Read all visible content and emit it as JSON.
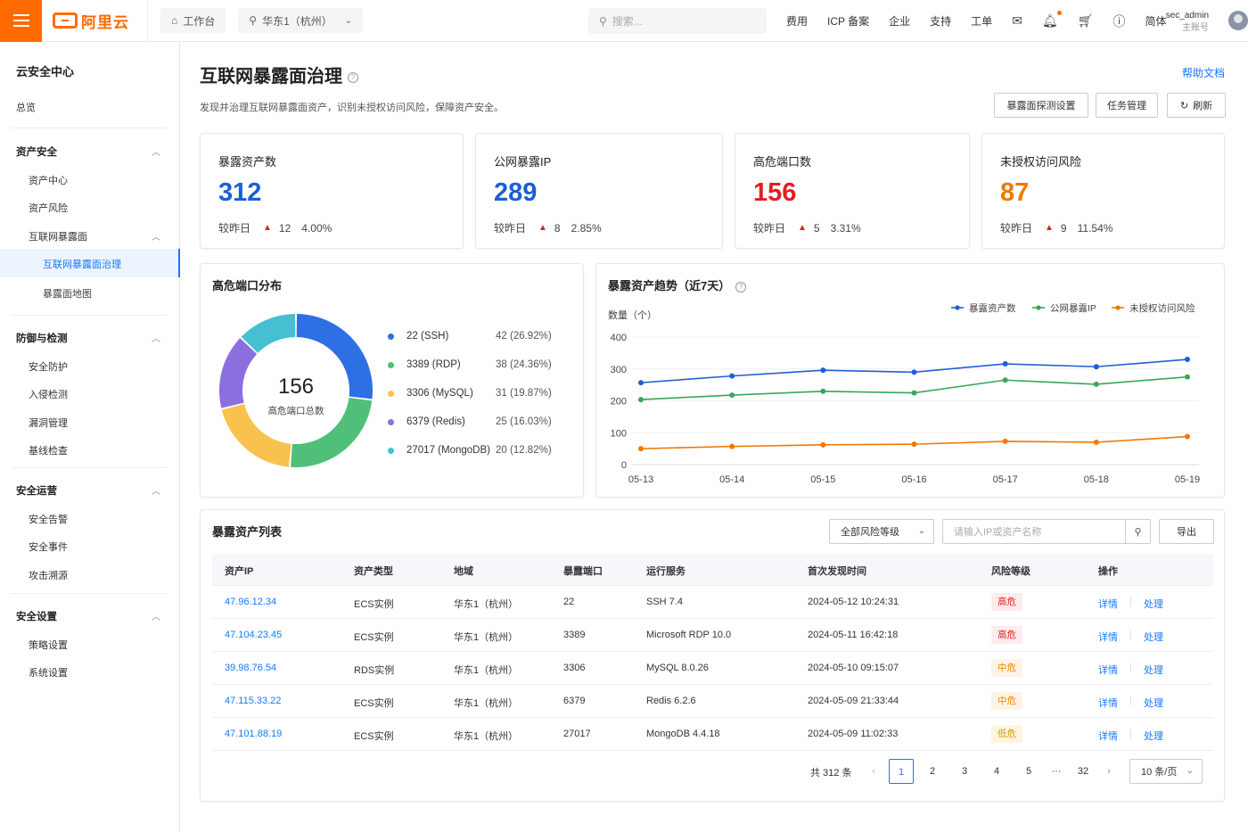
{
  "topbar": {
    "brand": "阿里云",
    "workbench": "工作台",
    "region": "华东1（杭州）",
    "search_placeholder": "搜索...",
    "nav": [
      "费用",
      "ICP 备案",
      "企业",
      "支持",
      "工单"
    ],
    "lang": "简体",
    "user_name": "sec_admin",
    "user_role": "主账号"
  },
  "sidebar": {
    "title": "云安全中心",
    "overview": "总览",
    "groups": [
      {
        "label": "资产安全",
        "items": [
          "资产中心",
          "资产风险"
        ]
      },
      {
        "label": "防御与检测",
        "items": [
          "安全防护",
          "入侵检测",
          "漏洞管理",
          "基线检查"
        ]
      },
      {
        "label": "安全运营",
        "items": [
          "安全告警",
          "安全事件",
          "攻击溯源"
        ]
      },
      {
        "label": "安全设置",
        "items": [
          "策略设置",
          "系统设置"
        ]
      }
    ],
    "sub_group": "互联网暴露面",
    "sub_items": [
      "互联网暴露面治理",
      "暴露面地图"
    ]
  },
  "page": {
    "title": "互联网暴露面治理",
    "help": "帮助文档",
    "desc": "发现并治理互联网暴露面资产，识别未授权访问风险，保障资产安全。",
    "buttons": {
      "probe": "暴露面探测设置",
      "task": "任务管理",
      "refresh": "刷新"
    }
  },
  "stats": [
    {
      "label": "暴露资产数",
      "value": "312",
      "cmp": "较昨日",
      "delta": "12",
      "pct": "4.00%",
      "color": "#1a5fd6"
    },
    {
      "label": "公网暴露IP",
      "value": "289",
      "cmp": "较昨日",
      "delta": "8",
      "pct": "2.85%",
      "color": "#1a5fd6"
    },
    {
      "label": "高危端口数",
      "value": "156",
      "cmp": "较昨日",
      "delta": "5",
      "pct": "3.31%",
      "color": "#e02020"
    },
    {
      "label": "未授权访问风险",
      "value": "87",
      "cmp": "较昨日",
      "delta": "9",
      "pct": "11.54%",
      "color": "#f07800"
    }
  ],
  "donut": {
    "title": "高危端口分布",
    "center_value": "156",
    "center_label": "高危端口总数",
    "legend": [
      {
        "name": "22 (SSH)",
        "pct": "42 (26.92%)"
      },
      {
        "name": "3389 (RDP)",
        "pct": "38 (24.36%)"
      },
      {
        "name": "3306 (MySQL)",
        "pct": "31 (19.87%)"
      },
      {
        "name": "6379 (Redis)",
        "pct": "25 (16.03%)"
      },
      {
        "name": "27017 (MongoDB)",
        "pct": "20 (12.82%)"
      }
    ]
  },
  "chart_data": {
    "type": "line",
    "title": "暴露资产趋势（近7天）",
    "ylabel": "数量（个）",
    "xlabel": "",
    "ylim": [
      0,
      400
    ],
    "yticks": [
      0,
      100,
      200,
      300,
      400
    ],
    "x": [
      "05-13",
      "05-14",
      "05-15",
      "05-16",
      "05-17",
      "05-18",
      "05-19"
    ],
    "legend_position": "top-right",
    "series": [
      {
        "name": "暴露资产数",
        "color": "#1f5fd6",
        "values": [
          257,
          278,
          296,
          290,
          316,
          307,
          330
        ]
      },
      {
        "name": "公网暴露IP",
        "color": "#3aa55a",
        "values": [
          204,
          218,
          230,
          225,
          265,
          252,
          275
        ]
      },
      {
        "name": "未授权访问风险",
        "color": "#f07800",
        "values": [
          50,
          57,
          62,
          64,
          73,
          70,
          88
        ]
      }
    ],
    "port_distribution": {
      "type": "pie",
      "categories": [
        "22 (SSH)",
        "3389 (RDP)",
        "3306 (MySQL)",
        "6379 (Redis)",
        "27017 (MongoDB)"
      ],
      "values": [
        42,
        38,
        31,
        25,
        20
      ],
      "colors": [
        "#2f6fe4",
        "#4fbf7a",
        "#f9c24f",
        "#8b6ee0",
        "#46bfd3"
      ]
    }
  },
  "table": {
    "title": "暴露资产列表",
    "risk_filter": "全部风险等级",
    "search_placeholder": "请输入IP或资产名称",
    "export": "导出",
    "headers": [
      "资产IP",
      "资产类型",
      "地域",
      "暴露端口",
      "运行服务",
      "首次发现时间",
      "风险等级",
      "操作"
    ],
    "rows": [
      {
        "ip": "47.96.12.34",
        "type": "ECS实例",
        "region": "华东1（杭州）",
        "port": "22",
        "service": "SSH 7.4",
        "time": "2024-05-12 10:24:31",
        "risk": "高危",
        "level": "h"
      },
      {
        "ip": "47.104.23.45",
        "type": "ECS实例",
        "region": "华东1（杭州）",
        "port": "3389",
        "service": "Microsoft RDP 10.0",
        "time": "2024-05-11 16:42:18",
        "risk": "高危",
        "level": "h"
      },
      {
        "ip": "39.98.76.54",
        "type": "RDS实例",
        "region": "华东1（杭州）",
        "port": "3306",
        "service": "MySQL 8.0.26",
        "time": "2024-05-10 09:15:07",
        "risk": "中危",
        "level": "m"
      },
      {
        "ip": "47.115.33.22",
        "type": "ECS实例",
        "region": "华东1（杭州）",
        "port": "6379",
        "service": "Redis 6.2.6",
        "time": "2024-05-09 21:33:44",
        "risk": "中危",
        "level": "m"
      },
      {
        "ip": "47.101.88.19",
        "type": "ECS实例",
        "region": "华东1（杭州）",
        "port": "27017",
        "service": "MongoDB 4.4.18",
        "time": "2024-05-09 11:02:33",
        "risk": "低危",
        "level": "l"
      }
    ],
    "op_detail": "详情",
    "op_handle": "处理",
    "total": "共 312 条",
    "pages": [
      "1",
      "2",
      "3",
      "4",
      "5",
      "···",
      "32"
    ],
    "page_size": "10 条/页"
  }
}
